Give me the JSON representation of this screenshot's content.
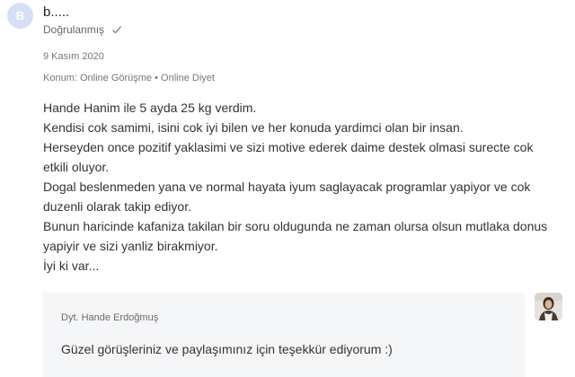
{
  "review": {
    "avatar_initial": "B",
    "author": "b.....",
    "verified_label": "Doğrulanmış",
    "date": "9 Kasım 2020",
    "topic": "Konum: Online Görüşme • Online Diyet",
    "body_lines": [
      "Hande Hanim ile 5 ayda 25 kg verdim.",
      "Kendisi cok samimi, isini cok iyi bilen ve her konuda yardimci olan bir insan.",
      "Herseyden once pozitif yaklasimi ve sizi motive ederek daime destek olmasi surecte cok etkili oluyor.",
      "Dogal beslenmeden yana ve normal hayata iyum saglayacak programlar yapiyor ve cok duzenli olarak takip ediyor.",
      "Bunun haricinde kafaniza takilan bir soru oldugunda ne zaman olursa olsun mutlaka donus yapiyir ve sizi yanliz birakmiyor.",
      "İyi ki var..."
    ]
  },
  "reply": {
    "author": "Dyt. Hande Erdoğmuş",
    "text": "Güzel görüşleriniz ve paylaşımınız için teşekkür ediyorum :)"
  },
  "icons": {
    "verified": "check-icon",
    "doctor_photo": "doctor-avatar-icon"
  },
  "colors": {
    "avatar_bg": "#d7dff4",
    "reply_bg": "#f5f6f8"
  }
}
